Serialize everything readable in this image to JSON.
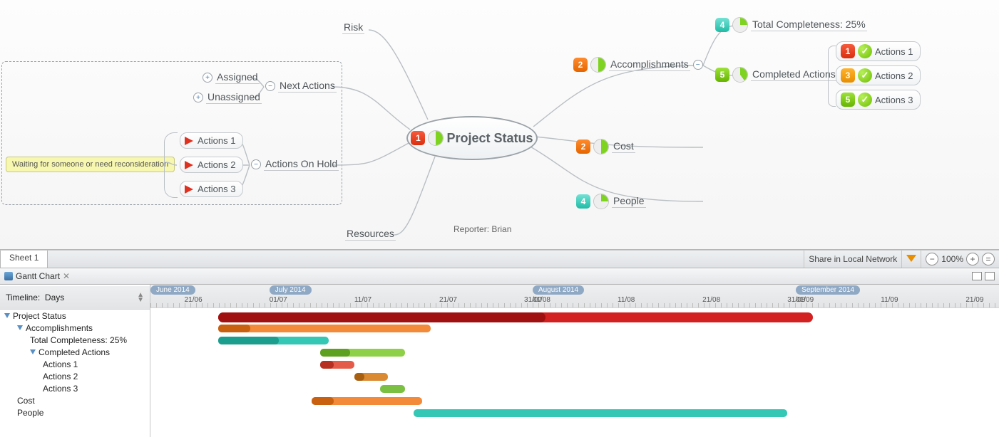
{
  "center": {
    "priority": "1",
    "label": "Project Status"
  },
  "reporter_label": "Reporter: Brian",
  "left": {
    "risk": "Risk",
    "next_actions": {
      "label": "Next Actions",
      "children": [
        "Assigned",
        "Unassigned"
      ]
    },
    "on_hold": {
      "label": "Actions On Hold",
      "children": [
        "Actions 1",
        "Actions 2",
        "Actions 3"
      ],
      "note": "Waiting for someone or need reconsideration"
    },
    "resources": "Resources"
  },
  "right": {
    "accomplishments": {
      "priority": "2",
      "label": "Accomplishments",
      "total": {
        "priority": "4",
        "label": "Total Completeness: 25%"
      },
      "completed": {
        "priority": "5",
        "label": "Completed Actions",
        "items": [
          {
            "priority": "1",
            "label": "Actions 1"
          },
          {
            "priority": "3",
            "label": "Actions 2"
          },
          {
            "priority": "5",
            "label": "Actions 3"
          }
        ]
      }
    },
    "cost": {
      "priority": "2",
      "label": "Cost"
    },
    "people": {
      "priority": "4",
      "label": "People"
    }
  },
  "sheet_tab": "Sheet 1",
  "share_label": "Share in Local Network",
  "zoom": "100%",
  "gantt": {
    "title": "Gantt Chart",
    "timeline_label": "Timeline:",
    "unit": "Days",
    "months": [
      "June 2014",
      "July 2014",
      "August 2014",
      "September 2014"
    ],
    "ticks": [
      "21/06",
      "01/07",
      "11/07",
      "21/07",
      "31/07",
      "01/08",
      "11/08",
      "21/08",
      "31/08",
      "01/09",
      "11/09",
      "21/09"
    ],
    "rows": [
      {
        "label": "Project Status",
        "indent": 0,
        "collapsible": true
      },
      {
        "label": "Accomplishments",
        "indent": 1,
        "collapsible": true
      },
      {
        "label": "Total Completeness: 25%",
        "indent": 2,
        "collapsible": false
      },
      {
        "label": "Completed Actions",
        "indent": 2,
        "collapsible": true
      },
      {
        "label": "Actions 1",
        "indent": 3,
        "collapsible": false
      },
      {
        "label": "Actions 2",
        "indent": 3,
        "collapsible": false
      },
      {
        "label": "Actions 3",
        "indent": 3,
        "collapsible": false
      },
      {
        "label": "Cost",
        "indent": 1,
        "collapsible": false
      },
      {
        "label": "People",
        "indent": 1,
        "collapsible": false
      }
    ]
  },
  "chart_data": {
    "type": "gantt",
    "time_axis": {
      "start": "2014-06-21",
      "end": "2014-09-25",
      "unit": "days"
    },
    "tasks": [
      {
        "name": "Project Status",
        "start": "2014-06-25",
        "end": "2014-09-03",
        "progress": 0.55,
        "color": "#d32020",
        "progress_color": "#a01010"
      },
      {
        "name": "Accomplishments",
        "start": "2014-06-25",
        "end": "2014-07-20",
        "progress": 0.15,
        "color": "#f28a3a",
        "progress_color": "#c96010"
      },
      {
        "name": "Total Completeness: 25%",
        "start": "2014-06-25",
        "end": "2014-07-08",
        "progress": 0.55,
        "color": "#34c7b5",
        "progress_color": "#1b9e8e"
      },
      {
        "name": "Completed Actions",
        "start": "2014-07-07",
        "end": "2014-07-17",
        "progress": 0.35,
        "color": "#8ed047",
        "progress_color": "#5ea020"
      },
      {
        "name": "Actions 1",
        "start": "2014-07-07",
        "end": "2014-07-11",
        "progress": 0.4,
        "color": "#e55b4a",
        "progress_color": "#b62f20"
      },
      {
        "name": "Actions 2",
        "start": "2014-07-11",
        "end": "2014-07-15",
        "progress": 0.3,
        "color": "#d98a32",
        "progress_color": "#a86010"
      },
      {
        "name": "Actions 3",
        "start": "2014-07-14",
        "end": "2014-07-17",
        "progress": 0.0,
        "color": "#7cc043",
        "progress_color": "#7cc043"
      },
      {
        "name": "Cost",
        "start": "2014-07-06",
        "end": "2014-07-19",
        "progress": 0.2,
        "color": "#f28a3a",
        "progress_color": "#c96010"
      },
      {
        "name": "People",
        "start": "2014-07-18",
        "end": "2014-08-31",
        "progress": 0.0,
        "color": "#34c7b5",
        "progress_color": "#34c7b5"
      }
    ]
  }
}
